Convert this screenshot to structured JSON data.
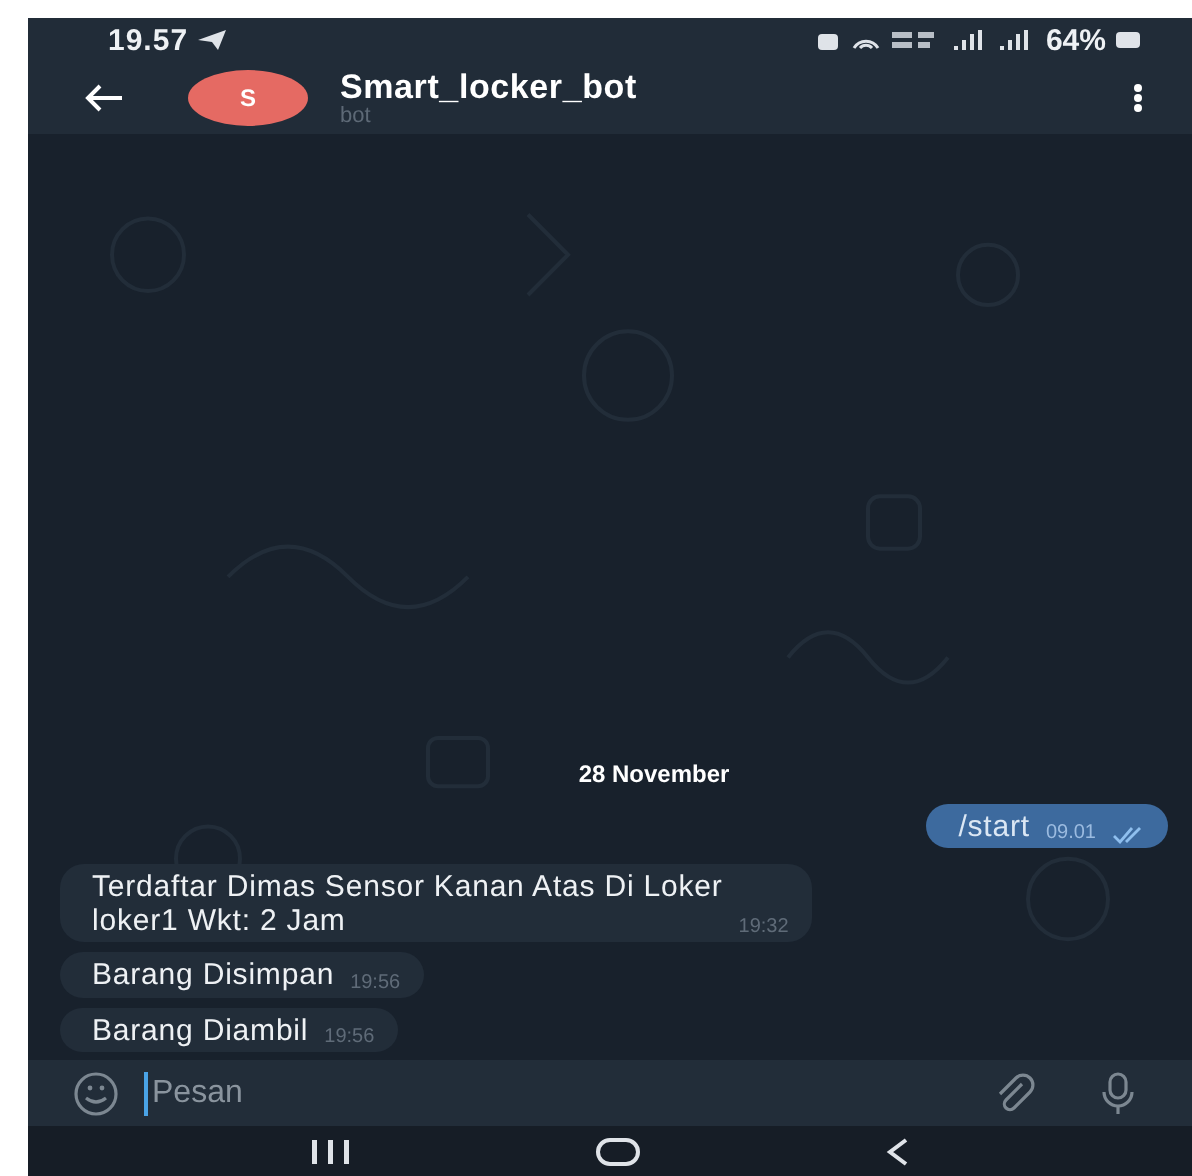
{
  "status_bar": {
    "time": "19.57",
    "battery": "64%"
  },
  "header": {
    "avatar_letter": "S",
    "title": "Smart_locker_bot",
    "subtitle": "bot"
  },
  "date_separator": "28 November",
  "messages": [
    {
      "kind": "outgoing",
      "text": "/start",
      "time": "09.01",
      "read": true
    },
    {
      "kind": "incoming",
      "text": "Terdaftar Dimas Sensor Kanan Atas Di Loker\nloker1  Wkt: 2 Jam",
      "time": "19:32"
    },
    {
      "kind": "incoming",
      "text": "Barang Disimpan",
      "time": "19:56"
    },
    {
      "kind": "incoming",
      "text": "Barang Diambil",
      "time": "19:56"
    }
  ],
  "composer": {
    "placeholder": "Pesan"
  }
}
